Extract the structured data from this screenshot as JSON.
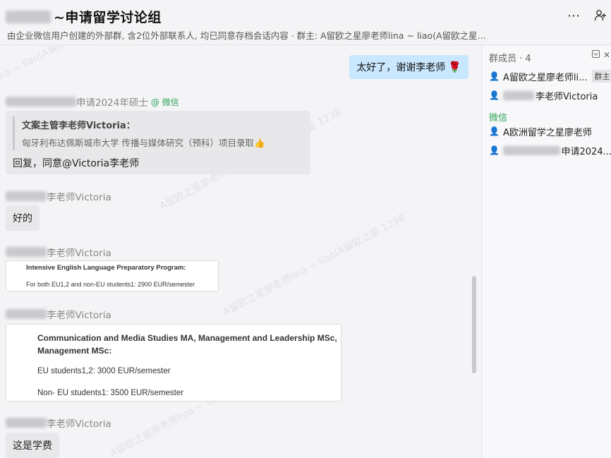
{
  "header": {
    "title": "~申请留学讨论组",
    "subtitle": "由企业微信用户创建的外部群, 含2位外部联系人, 均已同意存档会话内容 · 群主: A留欧之星廖老师lina ~ liao(A留欧之星...",
    "more_icon": "more-icon",
    "add_member_icon": "add-member-icon"
  },
  "watermark": {
    "text": "A留欧之星廖老师lina ~ liao(A留欧之星 1238"
  },
  "chat": {
    "messages": [
      {
        "type": "self",
        "text": "太好了，谢谢李老师",
        "emoji": "🌹"
      },
      {
        "type": "quote",
        "sender_suffix": "申请2024年硕士",
        "sender_tag": "@ 微信",
        "quote_author": "文案主管李老师Victoria：",
        "quote_text": "匈牙利布达佩斯城市大学 传播与媒体研究（预科）项目录取",
        "quote_emoji": "👍",
        "reply": "回复，同意@Victoria李老师"
      },
      {
        "type": "text",
        "sender_suffix": "李老师Victoria",
        "text": "好的"
      },
      {
        "type": "image",
        "sender_suffix": "李老师Victoria",
        "lines": [
          "Intensive English Language Preparatory Program:",
          "For both EU1,2 and non-EU students1: 2900 EUR/semester"
        ]
      },
      {
        "type": "image",
        "sender_suffix": "李老师Victoria",
        "lines": [
          "Communication and Media Studies MA, Management and Leadership MSc, Management MSc:",
          "EU students1,2: 3000 EUR/semester",
          "Non- EU students1: 3500 EUR/semester"
        ]
      },
      {
        "type": "text",
        "sender_suffix": "李老师Victoria",
        "text": "这是学费"
      }
    ]
  },
  "sidebar": {
    "title": "群成员 · 4",
    "collapse_icon": "collapse-icon",
    "close_icon": "close-icon",
    "section_wechat": "微信",
    "members": [
      {
        "name": "A留欧之星廖老师li...",
        "badge": "群主",
        "icon_color": "#e3953a"
      },
      {
        "name": "李老师Victoria",
        "badge": "",
        "icon_color": "#e3953a"
      },
      {
        "name": "A欧洲留学之星廖老师",
        "badge": "",
        "icon_color": "#e3953a"
      },
      {
        "name": "申请2024...",
        "badge": "",
        "icon_color": "#4a8fd8"
      }
    ]
  },
  "colors": {
    "self_bubble": "#c9e7ff",
    "other_bubble": "#e8e8eb",
    "wechat_green": "#2fa55a",
    "background": "#f4f4f6"
  }
}
